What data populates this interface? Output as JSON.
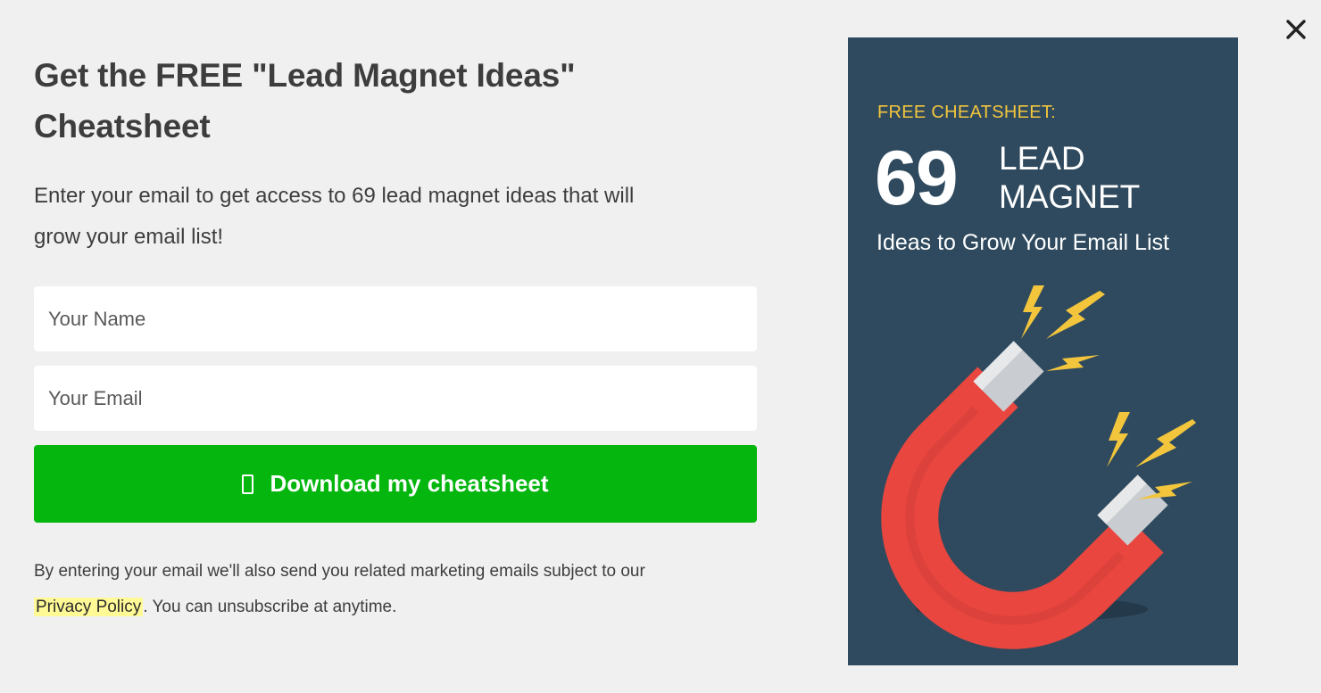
{
  "popup": {
    "title_line1": "Get the FREE \"Lead Magnet Ideas\"",
    "title_line2": "Cheatsheet",
    "subtitle_line1": "Enter your email to get access to 69 lead magnet ideas that will",
    "subtitle_line2": "grow your email list!",
    "name_placeholder": "Your Name",
    "email_placeholder": "Your Email",
    "submit_label": "Download my cheatsheet",
    "submit_icon": "download-icon",
    "disclaimer_prefix": "By entering your email we'll also send you related marketing emails subject to our",
    "privacy_link": "Privacy Policy",
    "disclaimer_suffix": ". You can unsubscribe at anytime.",
    "close_icon": "close-icon"
  },
  "cover": {
    "kicker": "FREE CHEATSHEET:",
    "number": "69",
    "word1": "LEAD",
    "word2": "MAGNET",
    "tagline": "Ideas to Grow Your Email List",
    "illustration": "magnet-icon"
  },
  "colors": {
    "background": "#f0f0f0",
    "text": "#3d3d3d",
    "button": "#05b60f",
    "privacy_highlight": "#fffa96",
    "cover_bg": "#2f4a5e",
    "cover_accent": "#f2c53d",
    "magnet_red": "#e8463f"
  }
}
